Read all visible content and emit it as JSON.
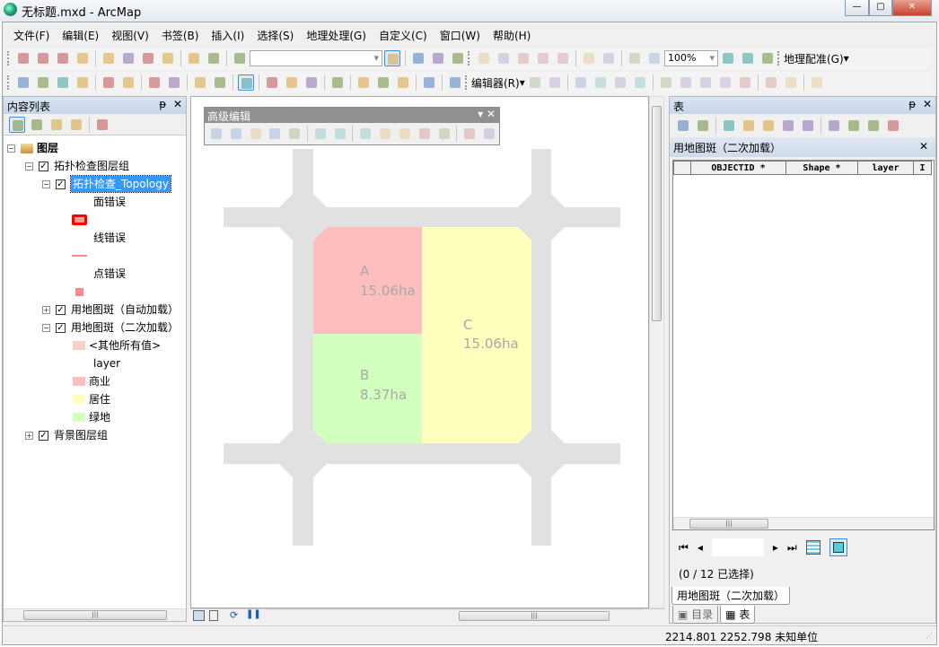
{
  "window": {
    "title": "无标题.mxd - ArcMap",
    "controls": [
      "minimize",
      "maximize",
      "close"
    ]
  },
  "menu": [
    "文件(F)",
    "编辑(E)",
    "视图(V)",
    "书签(B)",
    "插入(I)",
    "选择(S)",
    "地理处理(G)",
    "自定义(C)",
    "窗口(W)",
    "帮助(H)"
  ],
  "toolbar1": {
    "icons": [
      "new-document-icon",
      "open-folder-icon",
      "save-icon",
      "print-icon",
      "|",
      "cut-icon",
      "copy-icon",
      "paste-icon",
      "delete-icon",
      "|",
      "undo-icon",
      "redo-icon",
      "|",
      "add-data-icon"
    ],
    "scale_combo": "",
    "icons2": [
      "editor-toolbar-icon",
      "|",
      "table-of-contents-icon",
      "catalog-icon",
      "arc-toolbox-icon"
    ],
    "layout_icons": [
      "zoom-in-layout-icon",
      "zoom-out-layout-icon",
      "pan-layout-icon",
      "zoom-whole-page-icon",
      "zoom-100-icon",
      "|",
      "fixed-zoom-in-layout-icon",
      "fixed-zoom-out-layout-icon",
      "|",
      "back-extent-layout-icon",
      "forward-extent-layout-icon"
    ],
    "zoom_percent": "100%",
    "layout_icons2": [
      "toggle-draft-mode-icon",
      "focus-data-frame-icon",
      "change-layout-icon"
    ],
    "georef_label": "地理配准(G)"
  },
  "toolbar2": {
    "icons": [
      "zoom-in-icon",
      "zoom-out-icon",
      "pan-icon",
      "full-extent-icon",
      "|",
      "fixed-zoom-in-icon",
      "fixed-zoom-out-icon",
      "|",
      "back-icon",
      "forward-icon",
      "|",
      "select-features-icon",
      "clear-selection-icon",
      "|",
      "select-elements-icon",
      "|",
      "identify-icon",
      "hyperlink-icon",
      "html-popup-icon",
      "|",
      "measure-icon",
      "|",
      "find-icon",
      "find-route-icon",
      "go-to-xy-icon",
      "|",
      "time-slider-icon",
      "|",
      "magnifier-icon"
    ],
    "editor_label": "编辑器(R)",
    "edit_icons": [
      "edit-tool-icon",
      "edit-annotation-icon",
      "|",
      "straight-segment-icon",
      "end-point-arc-icon",
      "trace-icon",
      "point-icon",
      "|",
      "edit-vertices-icon",
      "reshape-icon",
      "cut-polygons-icon",
      "split-icon",
      "rotate-icon",
      "|",
      "attributes-icon",
      "sketch-properties-icon",
      "|",
      "create-features-icon"
    ]
  },
  "toc": {
    "title": "内容列表",
    "toolbar_icons": [
      "list-by-drawing-order-icon",
      "list-by-source-icon",
      "list-by-visibility-icon",
      "list-by-selection-icon",
      "|",
      "options-icon"
    ],
    "root": "图层",
    "items": {
      "topo_group": "拓扑检查图层组",
      "topology": "拓扑检查_Topology",
      "area_err": "面错误",
      "line_err": "线错误",
      "point_err": "点错误",
      "auto_layer": "用地图斑（自动加载）",
      "second_layer": "用地图斑（二次加载）",
      "other": "<其他所有值>",
      "field": "layer",
      "commercial": "商业",
      "residential": "居住",
      "green": "绿地",
      "bg_group": "背景图层组"
    }
  },
  "colors": {
    "commercial": "#ffbebe",
    "residential": "#ffffbe",
    "green": "#d3ffbe",
    "road": "#e1e1e1",
    "label": "#a8a8a8",
    "error": "#ff0000",
    "selection": "#3399ff"
  },
  "editbar": {
    "title": "高级编辑",
    "icons": [
      "copy-features-icon",
      "fillet-icon",
      "extend-icon",
      "trim-icon",
      "line-intersection-icon",
      "|",
      "explode-multipart-icon",
      "generalize-icon",
      "|",
      "align-to-shape-icon",
      "replace-geometry-icon",
      "construct-geometric-network-icon",
      "construct-polygons-icon",
      "split-polygons-icon",
      "|",
      "rectangle-icon",
      "circle-icon"
    ]
  },
  "map": {
    "parcels": [
      {
        "name": "A",
        "area": "15.06ha"
      },
      {
        "name": "B",
        "area": "8.37ha"
      },
      {
        "name": "C",
        "area": "15.06ha"
      }
    ]
  },
  "table": {
    "title": "表",
    "toolbar_icons": [
      "table-options-icon",
      "related-tables-icon",
      "|",
      "select-by-attributes-icon",
      "switch-selection-icon",
      "clear-selection-icon",
      "zoom-to-selected-icon",
      "delete-selected-icon",
      "|",
      "copy-selected-icon",
      "paste-icon",
      "zoom-icon",
      "delete-icon"
    ],
    "layer_title": "用地图斑（二次加载）",
    "columns": [
      "OBJECTID *",
      "Shape *",
      "layer",
      "I"
    ],
    "record": "",
    "selection_status": "(0 / 12 已选择)",
    "tab": "用地图斑（二次加载）",
    "bottom_tabs": [
      "目录",
      "表"
    ]
  },
  "status": {
    "coords": "2214.801  2252.798 未知单位"
  }
}
